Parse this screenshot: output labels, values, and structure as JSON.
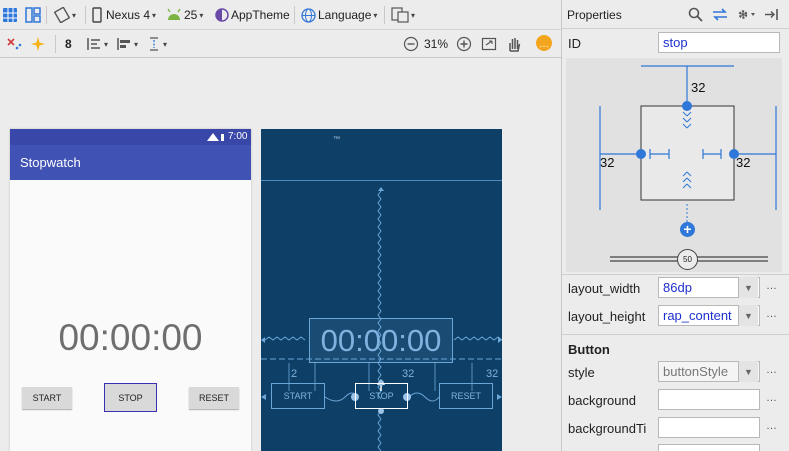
{
  "toolbar1": {
    "device": "Nexus 4",
    "api": "25",
    "theme": "AppTheme",
    "language": "Language"
  },
  "toolbar2": {
    "margin_value": "8",
    "zoom": "31%"
  },
  "preview": {
    "status_time": "7:00",
    "app_title": "Stopwatch",
    "timer": "00:00:00",
    "start_label": "START",
    "stop_label": "STOP",
    "reset_label": "RESET"
  },
  "blueprint": {
    "timer": "00:00:00",
    "start_label": "START",
    "stop_label": "STOP",
    "reset_label": "RESET",
    "margin_left": "2",
    "margin_mid": "32",
    "margin_right": "32"
  },
  "properties": {
    "title": "Properties",
    "id_label": "ID",
    "id_value": "stop",
    "constraint_top": "32",
    "constraint_left": "32",
    "constraint_right": "32",
    "bias": "50",
    "layout_width_label": "layout_width",
    "layout_width_value": "86dp",
    "layout_height_label": "layout_height",
    "layout_height_value": "rap_content",
    "section_title": "Button",
    "style_label": "style",
    "style_value": "buttonStyle",
    "background_label": "background",
    "background_tint_label": "backgroundTi",
    "background_value": "",
    "background_tint_value": ""
  },
  "colors": {
    "accent": "#4152b5",
    "blueprint": "#0e3f66",
    "constraint_blue": "#2f77d8"
  }
}
